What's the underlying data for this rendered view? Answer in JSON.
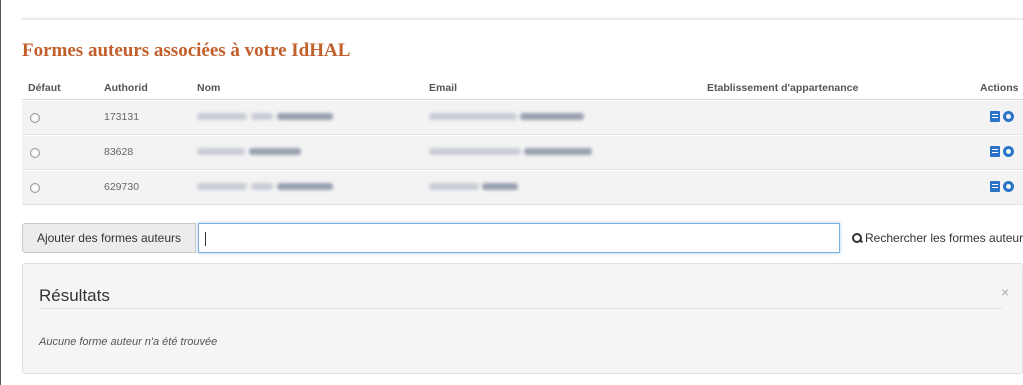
{
  "section_title": "Formes auteurs associées à votre IdHAL",
  "table": {
    "headers": {
      "default": "Défaut",
      "authorid": "Authorid",
      "name": "Nom",
      "email": "Email",
      "institution": "Etablissement d'appartenance",
      "actions": "Actions"
    },
    "rows": [
      {
        "authorid": "173131"
      },
      {
        "authorid": "83628"
      },
      {
        "authorid": "629730"
      }
    ],
    "action_icons": [
      "book-icon",
      "circle-icon"
    ]
  },
  "add_bar": {
    "add_label": "Ajouter des formes auteurs",
    "input_value": "",
    "search_label": "Rechercher les formes auteurs",
    "search_icon": "search-icon"
  },
  "results": {
    "title": "Résultats",
    "close_glyph": "×",
    "message": "Aucune forme auteur n'a été trouvée"
  },
  "colors": {
    "title": "#c2602c",
    "action_icons": "#2a73c6",
    "input_focus": "#7eb1e0"
  }
}
